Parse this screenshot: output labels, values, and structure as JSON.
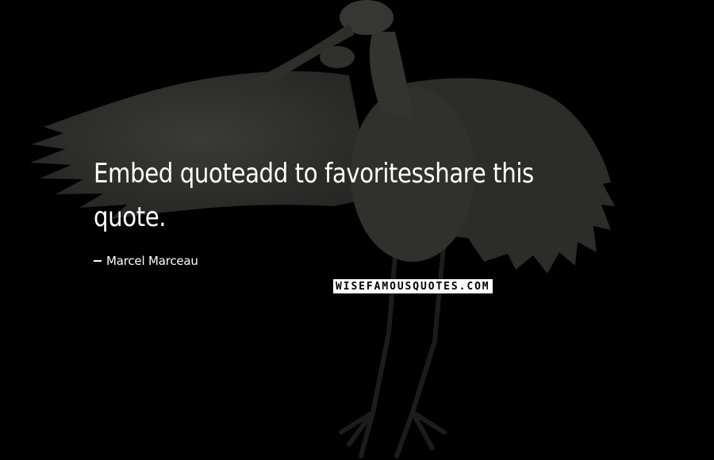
{
  "quote": {
    "text": "Embed quoteadd to favoritesshare this quote."
  },
  "author": {
    "name": "Marcel Marceau"
  },
  "watermark": {
    "text": "WISEFAMOUSQUOTES.COM"
  },
  "background": {
    "subject": "spoonbill-bird-spread-wings",
    "color": "#000000"
  }
}
